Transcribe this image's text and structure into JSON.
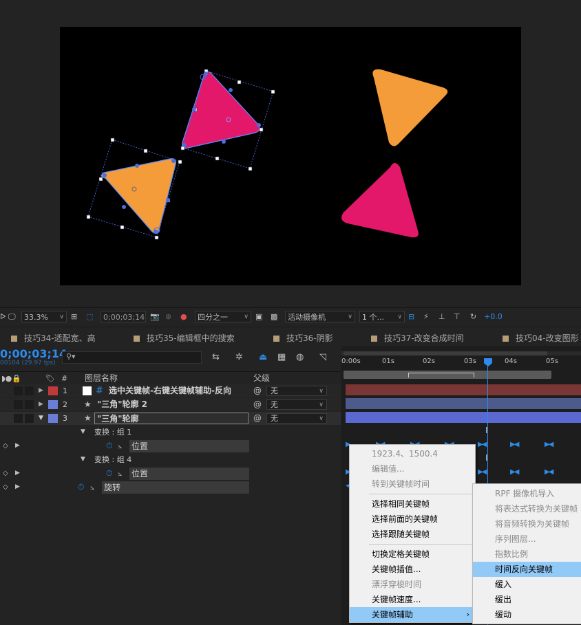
{
  "toolbar": {
    "zoom": "33.3%",
    "timecode": "0;00;03;14",
    "resolution": "四分之一",
    "camera": "活动摄像机",
    "views": "1 个...",
    "exposure": "+0.0"
  },
  "tabs": [
    {
      "label": "技巧34-适配宽、高"
    },
    {
      "label": "技巧35-编辑框中的搜索"
    },
    {
      "label": "技巧36-阴影"
    },
    {
      "label": "技巧37-改变合成时间"
    },
    {
      "label": "技巧04-改变图形"
    }
  ],
  "timeline": {
    "timecode": "0;00;03;14",
    "frame_info": "00104 (29.97 fps)",
    "search_placeholder": "",
    "col_hash": "#",
    "col_layer_name": "图层名称",
    "col_parent": "父级",
    "ruler": [
      "0:00s",
      "01s",
      "02s",
      "03s",
      "04s",
      "05s"
    ],
    "layers": [
      {
        "num": "1",
        "name": "选中关键帧-右键关键帧辅助-反向",
        "parent": "无",
        "color": "#c0393b",
        "type": "text"
      },
      {
        "num": "2",
        "name": "\"三角\"轮廓 2",
        "parent": "无",
        "color": "#6a7ed8",
        "type": "shape"
      },
      {
        "num": "3",
        "name": "\"三角\"轮廓",
        "parent": "无",
        "color": "#6a7ed8",
        "type": "shape"
      }
    ],
    "groups": [
      {
        "label": "变换 : 组 1",
        "prop": "位置"
      },
      {
        "label": "变换 : 组 4",
        "prop": "位置"
      }
    ],
    "rotation_label": "旋转"
  },
  "context_menu": {
    "value": "1923.4、1500.4",
    "items": [
      {
        "label": "编辑值...",
        "disabled": true
      },
      {
        "label": "转到关键帧时间",
        "disabled": true
      },
      {
        "label": "选择相同关键帧",
        "disabled": false
      },
      {
        "label": "选择前面的关键帧",
        "disabled": false
      },
      {
        "label": "选择跟随关键帧",
        "disabled": false
      },
      {
        "label": "切换定格关键帧",
        "disabled": false
      },
      {
        "label": "关键帧插值...",
        "disabled": false
      },
      {
        "label": "漂浮穿梭时间",
        "disabled": true
      },
      {
        "label": "关键帧速度...",
        "disabled": false
      },
      {
        "label": "关键帧辅助",
        "disabled": false
      }
    ]
  },
  "submenu": {
    "items": [
      {
        "label": "RPF 摄像机导入",
        "disabled": true
      },
      {
        "label": "将表达式转换为关键帧",
        "disabled": true
      },
      {
        "label": "将音频转换为关键帧",
        "disabled": true
      },
      {
        "label": "序列图层...",
        "disabled": true
      },
      {
        "label": "指数比例",
        "disabled": true
      },
      {
        "label": "时间反向关键帧",
        "disabled": false
      },
      {
        "label": "缓入",
        "disabled": false
      },
      {
        "label": "缓出",
        "disabled": false
      },
      {
        "label": "缓动",
        "disabled": false
      }
    ]
  },
  "colors": {
    "orange": "#f49b3a",
    "pink": "#e3186a",
    "accent_blue": "#2d8ceb",
    "selection_blue": "#91c9f7"
  }
}
